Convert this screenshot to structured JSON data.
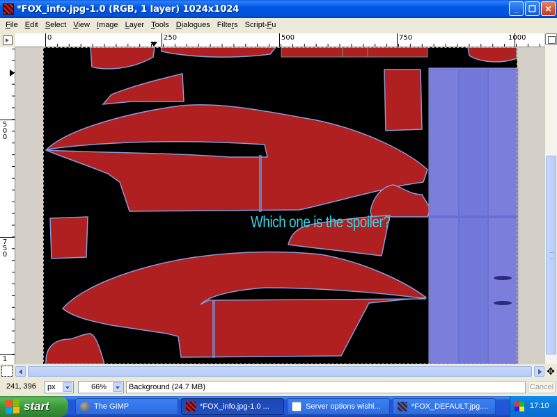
{
  "window": {
    "title": "*FOX_info.jpg-1.0 (RGB, 1 layer) 1024x1024",
    "buttons": {
      "minimize": "_",
      "maximize": "❐",
      "close": "✕"
    }
  },
  "menu": {
    "items": [
      {
        "pre": "",
        "u": "F",
        "post": "ile"
      },
      {
        "pre": "",
        "u": "E",
        "post": "dit"
      },
      {
        "pre": "",
        "u": "S",
        "post": "elect"
      },
      {
        "pre": "",
        "u": "V",
        "post": "iew"
      },
      {
        "pre": "",
        "u": "I",
        "post": "mage"
      },
      {
        "pre": "",
        "u": "L",
        "post": "ayer"
      },
      {
        "pre": "",
        "u": "T",
        "post": "ools"
      },
      {
        "pre": "",
        "u": "D",
        "post": "ialogues"
      },
      {
        "pre": "Filte",
        "u": "r",
        "post": "s"
      },
      {
        "pre": "Script-",
        "u": "F",
        "post": "u"
      }
    ]
  },
  "ruler": {
    "horizontal_labels": [
      "0",
      "250",
      "500",
      "750",
      "1000"
    ],
    "vertical_labels": [
      "500",
      "750",
      "1"
    ]
  },
  "canvas": {
    "annotation_text": "Which one is the spoiler?",
    "colors": {
      "background": "#000000",
      "part_fill": "#b02020",
      "part_outline": "#8a9ad8",
      "panel": "#7b7fd8",
      "annotation": "#39d5e6"
    }
  },
  "status": {
    "coordinates": "241, 396",
    "unit": "px",
    "zoom": "66%",
    "message": "Background (24.7 MB)",
    "cancel_label": "Cancel"
  },
  "taskbar": {
    "start_label": "start",
    "tasks": [
      {
        "label": "The GIMP",
        "icon": "gimp-icon",
        "active": false
      },
      {
        "label": "*FOX_info.jpg-1.0 ...",
        "icon": "image-icon",
        "active": true
      },
      {
        "label": "Server options wishl...",
        "icon": "browser-icon",
        "active": false
      },
      {
        "label": "*FOX_DEFAULT.jpg....",
        "icon": "image-icon",
        "active": false
      }
    ],
    "clock": "17:10"
  }
}
